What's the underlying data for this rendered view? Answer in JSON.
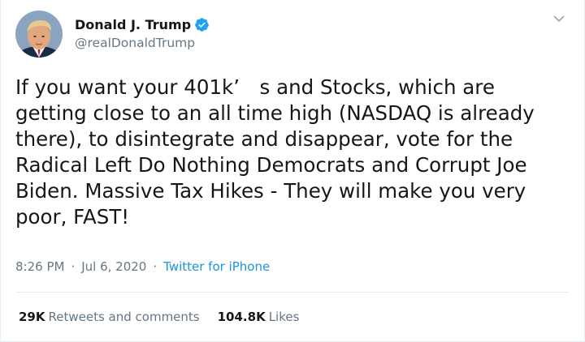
{
  "user": {
    "display_name": "Donald J. Trump",
    "handle": "@realDonaldTrump",
    "verified": true
  },
  "tweet": {
    "text": "If you want your 401k’ s  and Stocks, which are\ngetting close to an all time high (NASDAQ is already\nthere), to disintegrate and disappear, vote for the\nRadical Left Do Nothing Democrats and Corrupt Joe\nBiden. Massive Tax Hikes - They will make you very\npoor, FAST!",
    "time": "8:26 PM",
    "separator": "·",
    "date": "Jul 6, 2020",
    "source": "Twitter for iPhone"
  },
  "stats": {
    "retweets_count": "29K",
    "retweets_label": "Retweets and comments",
    "likes_count": "104.8K",
    "likes_label": "Likes"
  },
  "icons": {
    "verified": "verified-badge-icon",
    "menu": "chevron-down-icon"
  },
  "colors": {
    "text": "#14171a",
    "secondary": "#657786",
    "link": "#1b95e0",
    "verified": "#1da1f2",
    "divider": "#e6ecf0"
  }
}
